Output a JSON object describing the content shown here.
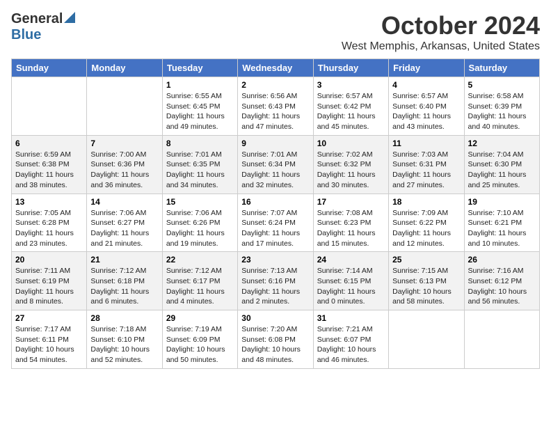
{
  "logo": {
    "general": "General",
    "blue": "Blue"
  },
  "title": "October 2024",
  "location": "West Memphis, Arkansas, United States",
  "days_of_week": [
    "Sunday",
    "Monday",
    "Tuesday",
    "Wednesday",
    "Thursday",
    "Friday",
    "Saturday"
  ],
  "weeks": [
    [
      {
        "day": "",
        "sunrise": "",
        "sunset": "",
        "daylight": ""
      },
      {
        "day": "",
        "sunrise": "",
        "sunset": "",
        "daylight": ""
      },
      {
        "day": "1",
        "sunrise": "Sunrise: 6:55 AM",
        "sunset": "Sunset: 6:45 PM",
        "daylight": "Daylight: 11 hours and 49 minutes."
      },
      {
        "day": "2",
        "sunrise": "Sunrise: 6:56 AM",
        "sunset": "Sunset: 6:43 PM",
        "daylight": "Daylight: 11 hours and 47 minutes."
      },
      {
        "day": "3",
        "sunrise": "Sunrise: 6:57 AM",
        "sunset": "Sunset: 6:42 PM",
        "daylight": "Daylight: 11 hours and 45 minutes."
      },
      {
        "day": "4",
        "sunrise": "Sunrise: 6:57 AM",
        "sunset": "Sunset: 6:40 PM",
        "daylight": "Daylight: 11 hours and 43 minutes."
      },
      {
        "day": "5",
        "sunrise": "Sunrise: 6:58 AM",
        "sunset": "Sunset: 6:39 PM",
        "daylight": "Daylight: 11 hours and 40 minutes."
      }
    ],
    [
      {
        "day": "6",
        "sunrise": "Sunrise: 6:59 AM",
        "sunset": "Sunset: 6:38 PM",
        "daylight": "Daylight: 11 hours and 38 minutes."
      },
      {
        "day": "7",
        "sunrise": "Sunrise: 7:00 AM",
        "sunset": "Sunset: 6:36 PM",
        "daylight": "Daylight: 11 hours and 36 minutes."
      },
      {
        "day": "8",
        "sunrise": "Sunrise: 7:01 AM",
        "sunset": "Sunset: 6:35 PM",
        "daylight": "Daylight: 11 hours and 34 minutes."
      },
      {
        "day": "9",
        "sunrise": "Sunrise: 7:01 AM",
        "sunset": "Sunset: 6:34 PM",
        "daylight": "Daylight: 11 hours and 32 minutes."
      },
      {
        "day": "10",
        "sunrise": "Sunrise: 7:02 AM",
        "sunset": "Sunset: 6:32 PM",
        "daylight": "Daylight: 11 hours and 30 minutes."
      },
      {
        "day": "11",
        "sunrise": "Sunrise: 7:03 AM",
        "sunset": "Sunset: 6:31 PM",
        "daylight": "Daylight: 11 hours and 27 minutes."
      },
      {
        "day": "12",
        "sunrise": "Sunrise: 7:04 AM",
        "sunset": "Sunset: 6:30 PM",
        "daylight": "Daylight: 11 hours and 25 minutes."
      }
    ],
    [
      {
        "day": "13",
        "sunrise": "Sunrise: 7:05 AM",
        "sunset": "Sunset: 6:28 PM",
        "daylight": "Daylight: 11 hours and 23 minutes."
      },
      {
        "day": "14",
        "sunrise": "Sunrise: 7:06 AM",
        "sunset": "Sunset: 6:27 PM",
        "daylight": "Daylight: 11 hours and 21 minutes."
      },
      {
        "day": "15",
        "sunrise": "Sunrise: 7:06 AM",
        "sunset": "Sunset: 6:26 PM",
        "daylight": "Daylight: 11 hours and 19 minutes."
      },
      {
        "day": "16",
        "sunrise": "Sunrise: 7:07 AM",
        "sunset": "Sunset: 6:24 PM",
        "daylight": "Daylight: 11 hours and 17 minutes."
      },
      {
        "day": "17",
        "sunrise": "Sunrise: 7:08 AM",
        "sunset": "Sunset: 6:23 PM",
        "daylight": "Daylight: 11 hours and 15 minutes."
      },
      {
        "day": "18",
        "sunrise": "Sunrise: 7:09 AM",
        "sunset": "Sunset: 6:22 PM",
        "daylight": "Daylight: 11 hours and 12 minutes."
      },
      {
        "day": "19",
        "sunrise": "Sunrise: 7:10 AM",
        "sunset": "Sunset: 6:21 PM",
        "daylight": "Daylight: 11 hours and 10 minutes."
      }
    ],
    [
      {
        "day": "20",
        "sunrise": "Sunrise: 7:11 AM",
        "sunset": "Sunset: 6:19 PM",
        "daylight": "Daylight: 11 hours and 8 minutes."
      },
      {
        "day": "21",
        "sunrise": "Sunrise: 7:12 AM",
        "sunset": "Sunset: 6:18 PM",
        "daylight": "Daylight: 11 hours and 6 minutes."
      },
      {
        "day": "22",
        "sunrise": "Sunrise: 7:12 AM",
        "sunset": "Sunset: 6:17 PM",
        "daylight": "Daylight: 11 hours and 4 minutes."
      },
      {
        "day": "23",
        "sunrise": "Sunrise: 7:13 AM",
        "sunset": "Sunset: 6:16 PM",
        "daylight": "Daylight: 11 hours and 2 minutes."
      },
      {
        "day": "24",
        "sunrise": "Sunrise: 7:14 AM",
        "sunset": "Sunset: 6:15 PM",
        "daylight": "Daylight: 11 hours and 0 minutes."
      },
      {
        "day": "25",
        "sunrise": "Sunrise: 7:15 AM",
        "sunset": "Sunset: 6:13 PM",
        "daylight": "Daylight: 10 hours and 58 minutes."
      },
      {
        "day": "26",
        "sunrise": "Sunrise: 7:16 AM",
        "sunset": "Sunset: 6:12 PM",
        "daylight": "Daylight: 10 hours and 56 minutes."
      }
    ],
    [
      {
        "day": "27",
        "sunrise": "Sunrise: 7:17 AM",
        "sunset": "Sunset: 6:11 PM",
        "daylight": "Daylight: 10 hours and 54 minutes."
      },
      {
        "day": "28",
        "sunrise": "Sunrise: 7:18 AM",
        "sunset": "Sunset: 6:10 PM",
        "daylight": "Daylight: 10 hours and 52 minutes."
      },
      {
        "day": "29",
        "sunrise": "Sunrise: 7:19 AM",
        "sunset": "Sunset: 6:09 PM",
        "daylight": "Daylight: 10 hours and 50 minutes."
      },
      {
        "day": "30",
        "sunrise": "Sunrise: 7:20 AM",
        "sunset": "Sunset: 6:08 PM",
        "daylight": "Daylight: 10 hours and 48 minutes."
      },
      {
        "day": "31",
        "sunrise": "Sunrise: 7:21 AM",
        "sunset": "Sunset: 6:07 PM",
        "daylight": "Daylight: 10 hours and 46 minutes."
      },
      {
        "day": "",
        "sunrise": "",
        "sunset": "",
        "daylight": ""
      },
      {
        "day": "",
        "sunrise": "",
        "sunset": "",
        "daylight": ""
      }
    ]
  ]
}
